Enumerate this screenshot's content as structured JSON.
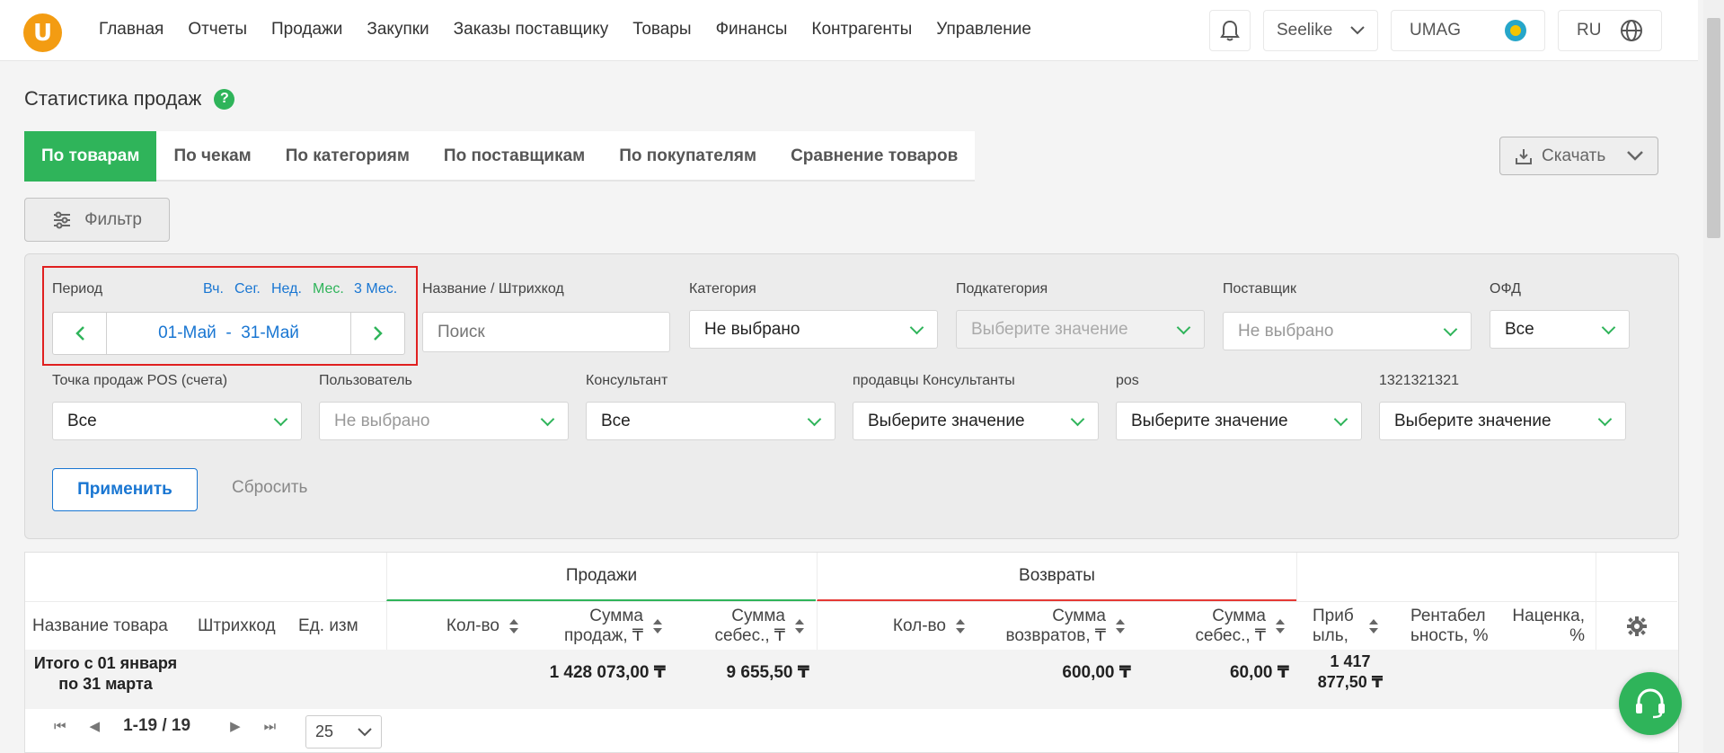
{
  "nav": {
    "logo_letter": "U",
    "items": [
      "Главная",
      "Отчеты",
      "Продажи",
      "Закупки",
      "Заказы поставщику",
      "Товары",
      "Финансы",
      "Контрагенты",
      "Управление"
    ]
  },
  "top_right": {
    "shop": "Seelike",
    "brand": "UMAG",
    "lang": "RU"
  },
  "page": {
    "title": "Статистика продаж",
    "help": "?"
  },
  "tabs": [
    "По товарам",
    "По чекам",
    "По категориям",
    "По поставщикам",
    "По покупателям",
    "Сравнение товаров"
  ],
  "actions": {
    "download": "Скачать",
    "filter": "Фильтр",
    "apply": "Применить",
    "reset": "Сбросить"
  },
  "period": {
    "label": "Период",
    "quick": [
      "Вч.",
      "Сег.",
      "Нед.",
      "Мес.",
      "3 Мес."
    ],
    "range": "01-Май  -  31-Май"
  },
  "filters": {
    "name_label": "Название / Штрихкод",
    "name_placeholder": "Поиск",
    "category_label": "Категория",
    "category_value": "Не выбрано",
    "subcategory_label": "Подкатегория",
    "subcategory_value": "Выберите значение",
    "supplier_label": "Поставщик",
    "supplier_value": "Не выбрано",
    "ofd_label": "ОФД",
    "ofd_value": "Все",
    "pos_label": "Точка продаж POS (счета)",
    "pos_value": "Все",
    "user_label": "Пользователь",
    "user_value": "Не выбрано",
    "consultant_label": "Консультант",
    "consultant_value": "Все",
    "sellers_label": "продавцы Консультанты",
    "sellers_value": "Выберите значение",
    "pos2_label": "pos",
    "pos2_value": "Выберите значение",
    "custom_label": "1321321321",
    "custom_value": "Выберите значение"
  },
  "table": {
    "groups": {
      "sales": "Продажи",
      "returns": "Возвраты"
    },
    "columns": {
      "name": "Название товара",
      "barcode": "Штрихкод",
      "unit": "Ед. изм",
      "qty": "Кол-во",
      "sales_sum": "Сумма продаж, ₸",
      "sales_cost": "Сумма себес., ₸",
      "ret_qty": "Кол-во",
      "ret_sum": "Сумма возвратов, ₸",
      "ret_cost": "Сумма себес., ₸",
      "profit": "Приб ыль,",
      "rentab": "Рентабел ьность, %",
      "markup": "Наценка, %"
    },
    "total": {
      "label": "Итого с 01 января по 31 марта",
      "sales_sum": "1 428 073,00 ₸",
      "sales_cost": "9 655,50 ₸",
      "ret_sum": "600,00 ₸",
      "ret_cost": "60,00 ₸",
      "profit": "1 417 877,50 ₸"
    }
  },
  "pager": {
    "range": "1-19 / 19",
    "page_size": "25"
  },
  "colors": {
    "accent_green": "#2fb45a",
    "link_blue": "#1976d2",
    "highlight_red": "#e02020",
    "logo_orange": "#f39c12"
  }
}
